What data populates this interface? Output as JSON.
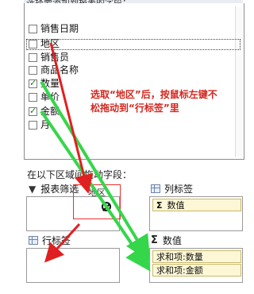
{
  "panel": {
    "header_text": "选择要添加到报表的字段："
  },
  "fields": [
    {
      "label": "销售日期",
      "checked": false
    },
    {
      "label": "地区",
      "checked": false
    },
    {
      "label": "销售员",
      "checked": false
    },
    {
      "label": "商品名称",
      "checked": false
    },
    {
      "label": "数量",
      "checked": true
    },
    {
      "label": "单价",
      "checked": false
    },
    {
      "label": "金额",
      "checked": true
    },
    {
      "label": "月",
      "checked": false
    }
  ],
  "areas": {
    "section_label": "在以下区域间拖动字段：",
    "report_filter": {
      "label": "报表筛选"
    },
    "column_labels": {
      "label": "列标签",
      "items": [
        "数值"
      ]
    },
    "row_labels": {
      "label": "行标签"
    },
    "values": {
      "label": "数值",
      "items": [
        "求和项:数量",
        "求和项:金额"
      ]
    }
  },
  "drag": {
    "ghost_text": "地区"
  },
  "annotation": {
    "text": "选取“地区”后，按鼠标左键不松拖动到“行标签”里"
  },
  "colors": {
    "arrow_red": "#e02020",
    "arrow_green": "#35d64a",
    "annotation": "#d2271f"
  }
}
